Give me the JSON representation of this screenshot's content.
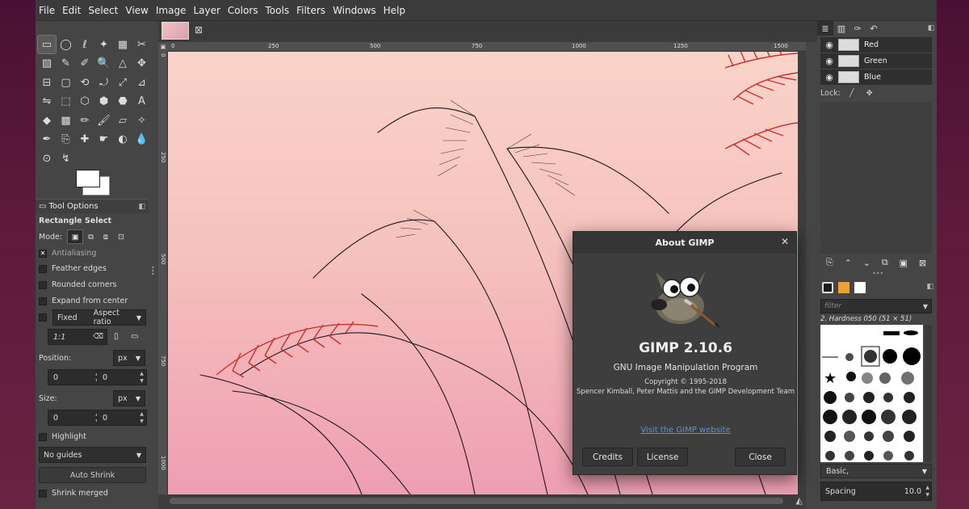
{
  "menubar": [
    "File",
    "Edit",
    "Select",
    "View",
    "Image",
    "Layer",
    "Colors",
    "Tools",
    "Filters",
    "Windows",
    "Help"
  ],
  "tool_options": {
    "header": "Tool Options",
    "tool_name": "Rectangle Select",
    "mode_label": "Mode:",
    "antialiasing": "Antialiasing",
    "feather_edges": "Feather edges",
    "rounded_corners": "Rounded corners",
    "expand_from_center": "Expand from center",
    "fixed": "Fixed",
    "aspect_ratio": "Aspect ratio",
    "ratio_value": "1:1",
    "position_label": "Position:",
    "position_unit": "px",
    "position_x": "0",
    "position_y": "0",
    "size_label": "Size:",
    "size_unit": "px",
    "size_w": "0",
    "size_h": "0",
    "highlight": "Highlight",
    "guides": "No guides",
    "auto_shrink": "Auto Shrink",
    "shrink_merged": "Shrink merged"
  },
  "ruler": {
    "h_ticks": [
      "0",
      "250",
      "500",
      "750",
      "1000",
      "1250",
      "1500"
    ],
    "v_ticks": [
      "0",
      "250",
      "500",
      "750",
      "1000"
    ]
  },
  "layers": {
    "channels": [
      "Red",
      "Green",
      "Blue"
    ],
    "lock_label": "Lock:"
  },
  "brushes": {
    "filter_placeholder": "filter",
    "current_brush": "2. Hardness 050 (51 × 51)",
    "preset": "Basic,",
    "spacing_label": "Spacing",
    "spacing_value": "10.0"
  },
  "about_dialog": {
    "title": "About GIMP",
    "version": "GIMP 2.10.6",
    "subtitle": "GNU Image Manipulation Program",
    "copyright": "Copyright © 1995-2018",
    "authors": "Spencer Kimball, Peter Mattis and the GIMP Development Team",
    "link": "Visit the GIMP website",
    "credits": "Credits",
    "license": "License",
    "close": "Close"
  },
  "colors": {
    "accent_link": "#5a93d8",
    "canvas_top": "#f9d3c9",
    "canvas_bottom": "#ee9eb2",
    "grass_red": "#c8201c"
  },
  "icons": {
    "tools": [
      "rect-select-icon",
      "ellipse-select-icon",
      "free-select-icon",
      "fuzzy-select-icon",
      "select-by-color-icon",
      "scissors-icon",
      "foreground-select-icon",
      "paths-icon",
      "color-picker-icon",
      "zoom-icon",
      "measure-icon",
      "move-icon",
      "align-icon",
      "crop-icon",
      "unified-transform-icon",
      "rotate-icon",
      "scale-icon",
      "shear-icon",
      "flip-icon",
      "perspective-icon",
      "cage-icon",
      "warp-icon",
      "handle-transform-icon",
      "text-icon",
      "bucket-fill-icon",
      "blend-icon",
      "pencil-icon",
      "paintbrush-icon",
      "eraser-icon",
      "airbrush-icon",
      "ink-icon",
      "clone-icon",
      "heal-icon",
      "smudge-icon",
      "dodge-icon",
      "blur-icon",
      "mypaint-icon",
      "warp-transform-icon"
    ]
  }
}
